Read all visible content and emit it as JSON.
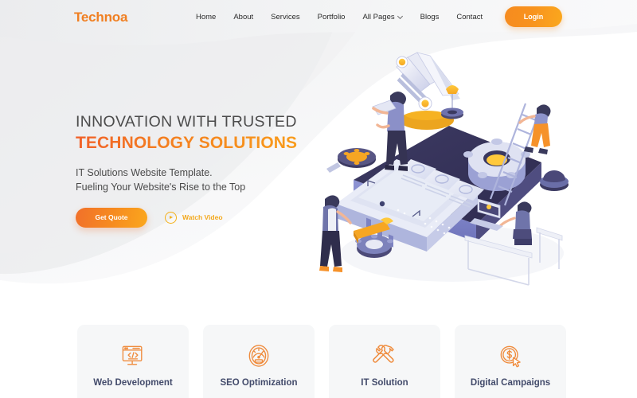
{
  "brand": {
    "name": "Technoa",
    "accent": "#f07f22"
  },
  "header": {
    "nav": [
      {
        "label": "Home",
        "icon": ""
      },
      {
        "label": "About",
        "icon": ""
      },
      {
        "label": "Services",
        "icon": ""
      },
      {
        "label": "Portfolio",
        "icon": ""
      },
      {
        "label": "All Pages",
        "icon": "chevron-down-icon"
      },
      {
        "label": "Blogs",
        "icon": ""
      },
      {
        "label": "Contact",
        "icon": ""
      }
    ],
    "login_label": "Login"
  },
  "hero": {
    "eyebrow": "INNOVATION WITH TRUSTED",
    "headline": "TECHNOLOGY SOLUTIONS",
    "sub_line1": "IT Solutions Website Template.",
    "sub_line2": "Fueling Your Website's Rise to the Top",
    "cta_primary": "Get Quote",
    "cta_secondary": "Watch Video",
    "illustration": "isometric-app-development-illustration"
  },
  "services": [
    {
      "title": "Web Development",
      "icon": "monitor-code-icon"
    },
    {
      "title": "SEO Optimization",
      "icon": "speedometer-gauge-icon"
    },
    {
      "title": "IT Solution",
      "icon": "wrench-screwdriver-icon"
    },
    {
      "title": "Digital Campaigns",
      "icon": "dollar-coin-cursor-icon"
    }
  ],
  "colors": {
    "orange": "#f47f20",
    "orange_deep": "#f1612a",
    "amber": "#f5b018",
    "card_bg": "#f6f7f8",
    "card_title": "#434b6b",
    "text_dark": "#4a4a4a"
  }
}
